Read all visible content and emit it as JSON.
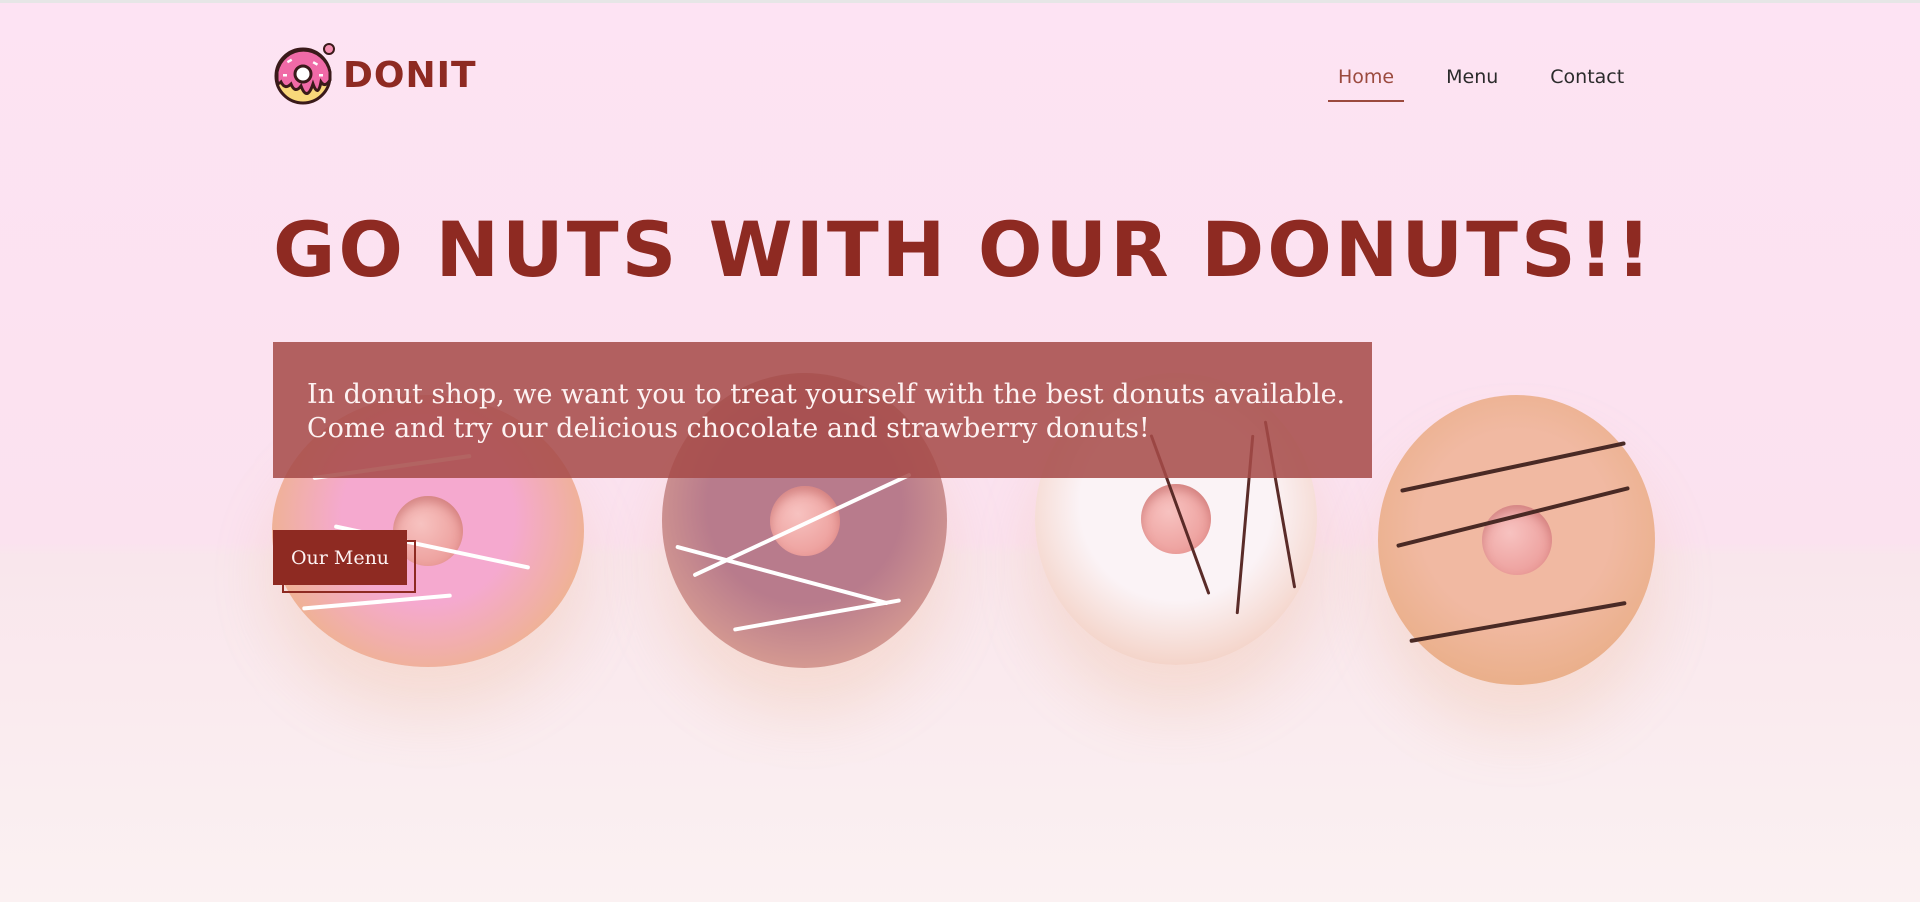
{
  "brand": {
    "name": "DONIT",
    "logo_icon": "donut-icon"
  },
  "nav": {
    "items": [
      {
        "label": "Home",
        "active": true
      },
      {
        "label": "Menu",
        "active": false
      },
      {
        "label": "Contact",
        "active": false
      }
    ]
  },
  "hero": {
    "headline": "GO NUTS WITH OUR DONUTS!!",
    "intro_line1": "In donut shop, we want you to treat yourself with the best donuts available.",
    "intro_line2": "Come and try our delicious chocolate and strawberry donuts!",
    "cta_label": "Our Menu"
  },
  "colors": {
    "brand": "#8e2a22",
    "nav_active": "#9b4a3e",
    "intro_box": "#a54b48",
    "background_pink": "#fde3f3"
  }
}
